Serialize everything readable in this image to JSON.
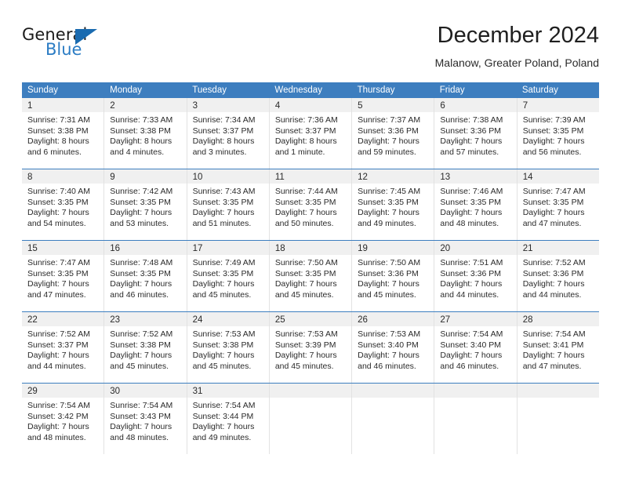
{
  "logo": {
    "word_top": "General",
    "word_bottom": "Blue",
    "accent_color": "#1a6bb0"
  },
  "header": {
    "title": "December 2024",
    "subtitle": "Malanow, Greater Poland, Poland"
  },
  "theme": {
    "header_blue": "#3d7ebf",
    "day_band_gray": "#f0f0f0",
    "grid_line": "#e2e2e2",
    "text": "#2a2a2a"
  },
  "weekdays": [
    "Sunday",
    "Monday",
    "Tuesday",
    "Wednesday",
    "Thursday",
    "Friday",
    "Saturday"
  ],
  "weeks": [
    [
      {
        "day": "1",
        "sunrise": "Sunrise: 7:31 AM",
        "sunset": "Sunset: 3:38 PM",
        "daylight1": "Daylight: 8 hours",
        "daylight2": "and 6 minutes."
      },
      {
        "day": "2",
        "sunrise": "Sunrise: 7:33 AM",
        "sunset": "Sunset: 3:38 PM",
        "daylight1": "Daylight: 8 hours",
        "daylight2": "and 4 minutes."
      },
      {
        "day": "3",
        "sunrise": "Sunrise: 7:34 AM",
        "sunset": "Sunset: 3:37 PM",
        "daylight1": "Daylight: 8 hours",
        "daylight2": "and 3 minutes."
      },
      {
        "day": "4",
        "sunrise": "Sunrise: 7:36 AM",
        "sunset": "Sunset: 3:37 PM",
        "daylight1": "Daylight: 8 hours",
        "daylight2": "and 1 minute."
      },
      {
        "day": "5",
        "sunrise": "Sunrise: 7:37 AM",
        "sunset": "Sunset: 3:36 PM",
        "daylight1": "Daylight: 7 hours",
        "daylight2": "and 59 minutes."
      },
      {
        "day": "6",
        "sunrise": "Sunrise: 7:38 AM",
        "sunset": "Sunset: 3:36 PM",
        "daylight1": "Daylight: 7 hours",
        "daylight2": "and 57 minutes."
      },
      {
        "day": "7",
        "sunrise": "Sunrise: 7:39 AM",
        "sunset": "Sunset: 3:35 PM",
        "daylight1": "Daylight: 7 hours",
        "daylight2": "and 56 minutes."
      }
    ],
    [
      {
        "day": "8",
        "sunrise": "Sunrise: 7:40 AM",
        "sunset": "Sunset: 3:35 PM",
        "daylight1": "Daylight: 7 hours",
        "daylight2": "and 54 minutes."
      },
      {
        "day": "9",
        "sunrise": "Sunrise: 7:42 AM",
        "sunset": "Sunset: 3:35 PM",
        "daylight1": "Daylight: 7 hours",
        "daylight2": "and 53 minutes."
      },
      {
        "day": "10",
        "sunrise": "Sunrise: 7:43 AM",
        "sunset": "Sunset: 3:35 PM",
        "daylight1": "Daylight: 7 hours",
        "daylight2": "and 51 minutes."
      },
      {
        "day": "11",
        "sunrise": "Sunrise: 7:44 AM",
        "sunset": "Sunset: 3:35 PM",
        "daylight1": "Daylight: 7 hours",
        "daylight2": "and 50 minutes."
      },
      {
        "day": "12",
        "sunrise": "Sunrise: 7:45 AM",
        "sunset": "Sunset: 3:35 PM",
        "daylight1": "Daylight: 7 hours",
        "daylight2": "and 49 minutes."
      },
      {
        "day": "13",
        "sunrise": "Sunrise: 7:46 AM",
        "sunset": "Sunset: 3:35 PM",
        "daylight1": "Daylight: 7 hours",
        "daylight2": "and 48 minutes."
      },
      {
        "day": "14",
        "sunrise": "Sunrise: 7:47 AM",
        "sunset": "Sunset: 3:35 PM",
        "daylight1": "Daylight: 7 hours",
        "daylight2": "and 47 minutes."
      }
    ],
    [
      {
        "day": "15",
        "sunrise": "Sunrise: 7:47 AM",
        "sunset": "Sunset: 3:35 PM",
        "daylight1": "Daylight: 7 hours",
        "daylight2": "and 47 minutes."
      },
      {
        "day": "16",
        "sunrise": "Sunrise: 7:48 AM",
        "sunset": "Sunset: 3:35 PM",
        "daylight1": "Daylight: 7 hours",
        "daylight2": "and 46 minutes."
      },
      {
        "day": "17",
        "sunrise": "Sunrise: 7:49 AM",
        "sunset": "Sunset: 3:35 PM",
        "daylight1": "Daylight: 7 hours",
        "daylight2": "and 45 minutes."
      },
      {
        "day": "18",
        "sunrise": "Sunrise: 7:50 AM",
        "sunset": "Sunset: 3:35 PM",
        "daylight1": "Daylight: 7 hours",
        "daylight2": "and 45 minutes."
      },
      {
        "day": "19",
        "sunrise": "Sunrise: 7:50 AM",
        "sunset": "Sunset: 3:36 PM",
        "daylight1": "Daylight: 7 hours",
        "daylight2": "and 45 minutes."
      },
      {
        "day": "20",
        "sunrise": "Sunrise: 7:51 AM",
        "sunset": "Sunset: 3:36 PM",
        "daylight1": "Daylight: 7 hours",
        "daylight2": "and 44 minutes."
      },
      {
        "day": "21",
        "sunrise": "Sunrise: 7:52 AM",
        "sunset": "Sunset: 3:36 PM",
        "daylight1": "Daylight: 7 hours",
        "daylight2": "and 44 minutes."
      }
    ],
    [
      {
        "day": "22",
        "sunrise": "Sunrise: 7:52 AM",
        "sunset": "Sunset: 3:37 PM",
        "daylight1": "Daylight: 7 hours",
        "daylight2": "and 44 minutes."
      },
      {
        "day": "23",
        "sunrise": "Sunrise: 7:52 AM",
        "sunset": "Sunset: 3:38 PM",
        "daylight1": "Daylight: 7 hours",
        "daylight2": "and 45 minutes."
      },
      {
        "day": "24",
        "sunrise": "Sunrise: 7:53 AM",
        "sunset": "Sunset: 3:38 PM",
        "daylight1": "Daylight: 7 hours",
        "daylight2": "and 45 minutes."
      },
      {
        "day": "25",
        "sunrise": "Sunrise: 7:53 AM",
        "sunset": "Sunset: 3:39 PM",
        "daylight1": "Daylight: 7 hours",
        "daylight2": "and 45 minutes."
      },
      {
        "day": "26",
        "sunrise": "Sunrise: 7:53 AM",
        "sunset": "Sunset: 3:40 PM",
        "daylight1": "Daylight: 7 hours",
        "daylight2": "and 46 minutes."
      },
      {
        "day": "27",
        "sunrise": "Sunrise: 7:54 AM",
        "sunset": "Sunset: 3:40 PM",
        "daylight1": "Daylight: 7 hours",
        "daylight2": "and 46 minutes."
      },
      {
        "day": "28",
        "sunrise": "Sunrise: 7:54 AM",
        "sunset": "Sunset: 3:41 PM",
        "daylight1": "Daylight: 7 hours",
        "daylight2": "and 47 minutes."
      }
    ],
    [
      {
        "day": "29",
        "sunrise": "Sunrise: 7:54 AM",
        "sunset": "Sunset: 3:42 PM",
        "daylight1": "Daylight: 7 hours",
        "daylight2": "and 48 minutes."
      },
      {
        "day": "30",
        "sunrise": "Sunrise: 7:54 AM",
        "sunset": "Sunset: 3:43 PM",
        "daylight1": "Daylight: 7 hours",
        "daylight2": "and 48 minutes."
      },
      {
        "day": "31",
        "sunrise": "Sunrise: 7:54 AM",
        "sunset": "Sunset: 3:44 PM",
        "daylight1": "Daylight: 7 hours",
        "daylight2": "and 49 minutes."
      },
      {
        "day": "",
        "sunrise": "",
        "sunset": "",
        "daylight1": "",
        "daylight2": ""
      },
      {
        "day": "",
        "sunrise": "",
        "sunset": "",
        "daylight1": "",
        "daylight2": ""
      },
      {
        "day": "",
        "sunrise": "",
        "sunset": "",
        "daylight1": "",
        "daylight2": ""
      },
      {
        "day": "",
        "sunrise": "",
        "sunset": "",
        "daylight1": "",
        "daylight2": ""
      }
    ]
  ]
}
